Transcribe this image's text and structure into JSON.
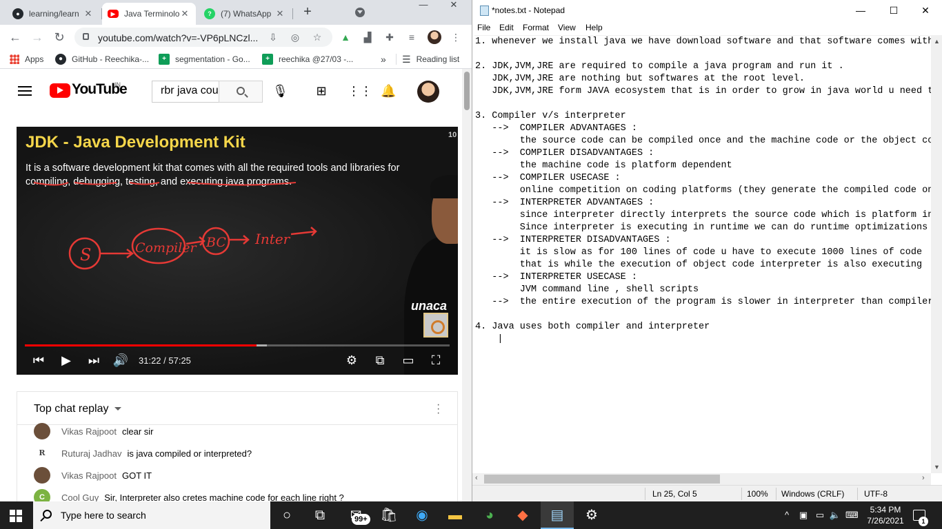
{
  "chrome": {
    "tabs": [
      {
        "title": "learning/learn",
        "active": false
      },
      {
        "title": "Java Terminolo",
        "active": true
      },
      {
        "title": "(7) WhatsApp",
        "active": false
      }
    ],
    "new_tab": "+",
    "url": "youtube.com/watch?v=-VP6pLNCzl...",
    "bookmarks": [
      {
        "label": "Apps",
        "icon": "apps-grid-icon"
      },
      {
        "label": "GitHub - Reechika-...",
        "icon": "github-icon"
      },
      {
        "label": "segmentation - Go...",
        "icon": "sheets-icon"
      },
      {
        "label": "reechika @27/03 -...",
        "icon": "sheets-icon"
      }
    ],
    "bookmarks_overflow": "»",
    "reading_list": "Reading list"
  },
  "youtube": {
    "logo_text": "YouTube",
    "country": "IN",
    "search_value": "rbr java cou",
    "video": {
      "title": "JDK - Java Development Kit",
      "text": "It is a software development kit that comes with all the required tools and libraries for compiling, debugging, testing, and executing java programs.",
      "corner_number": "10",
      "watermark": "unaca",
      "diagram": {
        "s": "S",
        "compiler": "Compiler",
        "bc": "BC",
        "inter": "Inter"
      },
      "current_time": "31:22",
      "total_time": "57:25",
      "time_display": "31:22 / 57:25",
      "played_fraction": 0.546,
      "loaded_fraction": 0.57
    },
    "chat": {
      "title": "Top chat replay",
      "messages": [
        {
          "author": "Vikas Rajpoot",
          "message": "clear sir",
          "avatar": "",
          "avatar_color": "#6b4f3a"
        },
        {
          "author": "Ruturaj Jadhav",
          "message": "is java compiled or interpreted?",
          "avatar": "R",
          "avatar_color": "#ffffff"
        },
        {
          "author": "Vikas Rajpoot",
          "message": "GOT IT",
          "avatar": "",
          "avatar_color": "#6b4f3a"
        },
        {
          "author": "Cool Guy",
          "message": "Sir, Interpreter also cretes machine code for each line right ?",
          "avatar": "C",
          "avatar_color": "#7cb342"
        }
      ]
    }
  },
  "notepad": {
    "title": "*notes.txt - Notepad",
    "menu": [
      "File",
      "Edit",
      "Format",
      "View",
      "Help"
    ],
    "lines": [
      "1. whenever we install java we have download software and that software comes with",
      "",
      "2. JDK,JVM,JRE are required to compile a java program and run it .",
      "   JDK,JVM,JRE are nothing but softwares at the root level.",
      "   JDK,JVM,JRE form JAVA ecosystem that is in order to grow in java world u need t",
      "",
      "3. Compiler v/s interpreter",
      "   -->  COMPILER ADVANTAGES :",
      "        the source code can be compiled once and the machine code or the object co",
      "   -->  COMPILER DISADVANTAGES :",
      "        the machine code is platform dependent",
      "   -->  COMPILER USECASE :",
      "        online competition on coding platforms (they generate the compiled code on",
      "   -->  INTERPRETER ADVANTAGES :",
      "        since interpreter directly interprets the source code which is platform in",
      "        Since interpreter is executing in runtime we can do runtime optimizations",
      "   -->  INTERPRETER DISADVANTAGES :",
      "        it is slow as for 100 lines of code u have to execute 1000 lines of code",
      "        that is while the execution of object code interpreter is also executing",
      "   -->  INTERPRETER USECASE :",
      "        JVM command line , shell scripts",
      "   -->  the entire execution of the program is slower in interpreter than compiler",
      "",
      "4. Java uses both compiler and interpreter",
      "    |"
    ],
    "status": {
      "position": "Ln 25, Col 5",
      "zoom": "100%",
      "line_ending": "Windows (CRLF)",
      "encoding": "UTF-8"
    }
  },
  "taskbar": {
    "search_placeholder": "Type here to search",
    "mail_badge": "99+",
    "time": "5:34 PM",
    "date": "7/26/2021",
    "notification_count": "1"
  }
}
